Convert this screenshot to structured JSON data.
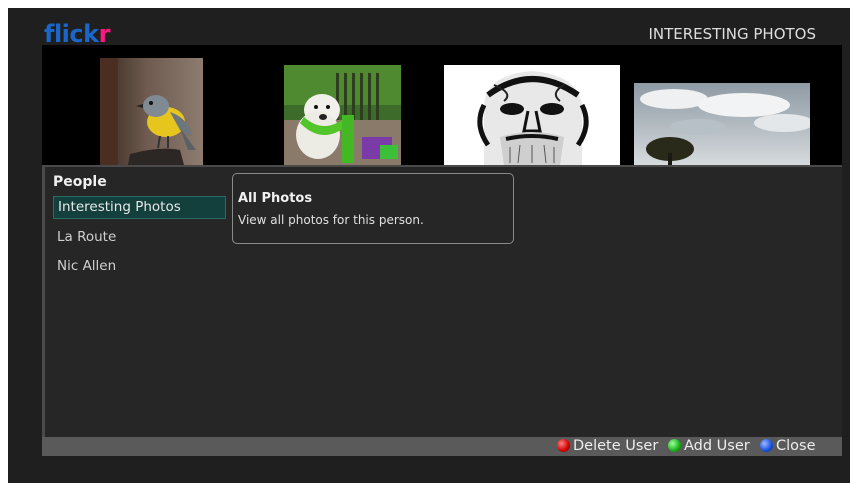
{
  "header": {
    "logo_part1": "flick",
    "logo_part2": "r",
    "title": "INTERESTING PHOTOS"
  },
  "photos": [
    {
      "subject": "yellow-robin-bird"
    },
    {
      "subject": "dog-with-toy"
    },
    {
      "subject": "old-man-portrait"
    },
    {
      "subject": "tree-under-clouds"
    }
  ],
  "people": {
    "title": "People",
    "items": [
      {
        "label": "Interesting Photos",
        "selected": true
      },
      {
        "label": "La Route",
        "selected": false
      },
      {
        "label": "Nic Allen",
        "selected": false
      }
    ]
  },
  "tooltip": {
    "title": "All Photos",
    "description": "View all photos for this person."
  },
  "footer": {
    "delete_label": "Delete User",
    "add_label": "Add User",
    "close_label": "Close"
  },
  "colors": {
    "logo_blue": "#1b66c9",
    "logo_pink": "#ff1681",
    "selection": "#133f3c",
    "red_button": "#d00000",
    "green_button": "#18b018",
    "blue_button": "#1650e0"
  }
}
